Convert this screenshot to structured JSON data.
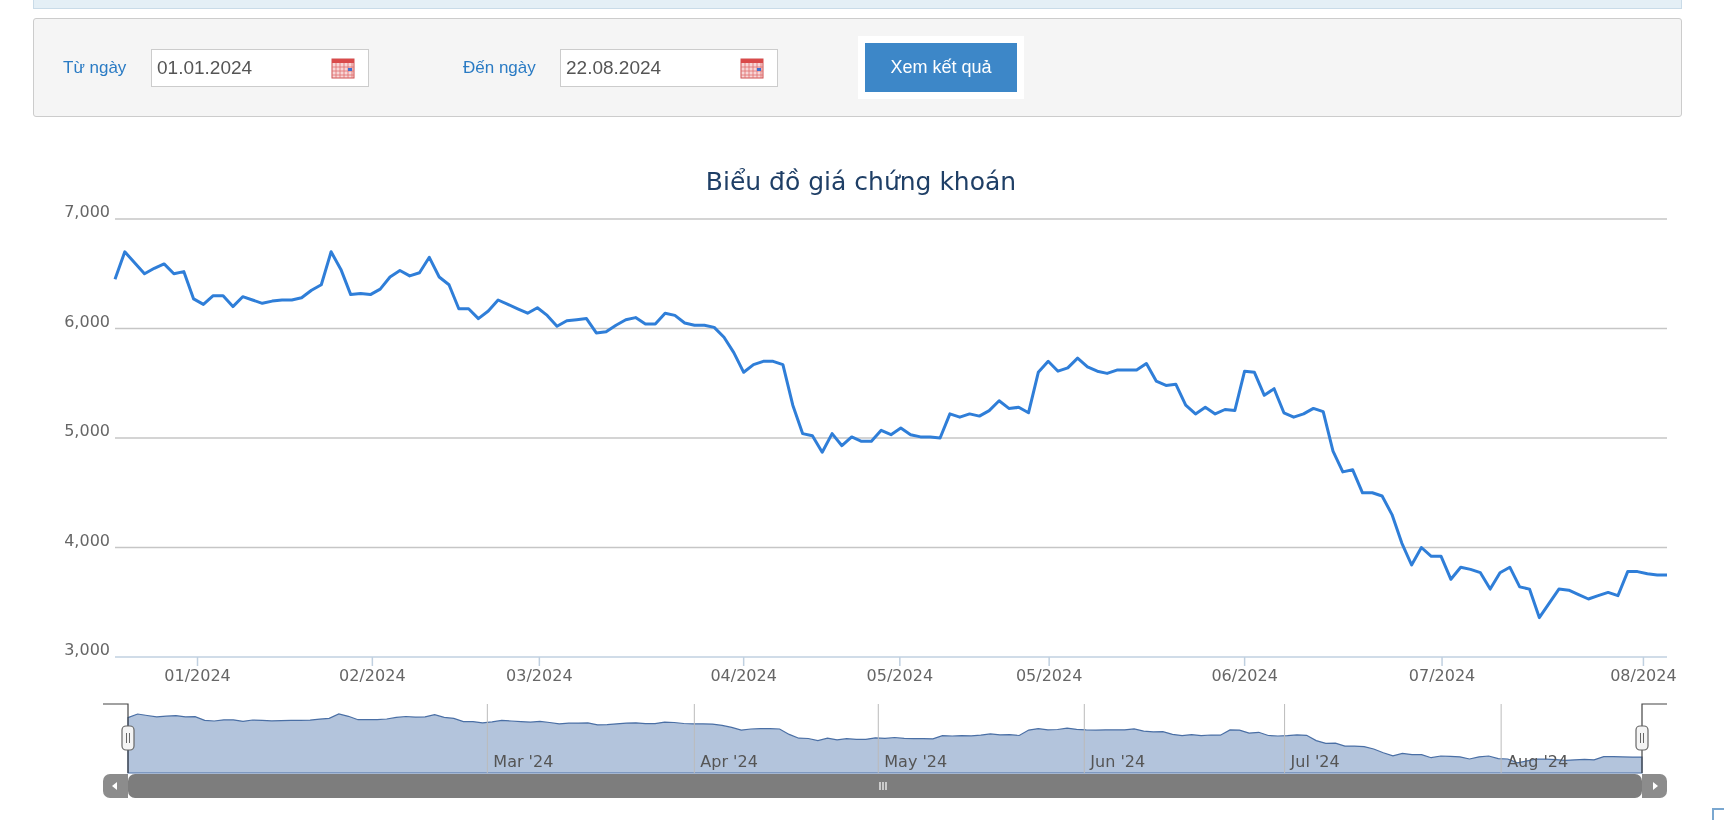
{
  "filter": {
    "from_label": "Từ ngày",
    "from_value": "01.01.2024",
    "to_label": "Đến ngày",
    "to_value": "22.08.2024",
    "submit": "Xem kết quả"
  },
  "chart": {
    "chart_data": {
      "type": "line",
      "title": "Biểu đồ giá chứng khoán",
      "grid": true,
      "ylim": [
        3000,
        7000
      ],
      "yticks": [
        {
          "value": 3000,
          "label": "3,000"
        },
        {
          "value": 4000,
          "label": "4,000"
        },
        {
          "value": 5000,
          "label": "5,000"
        },
        {
          "value": 6000,
          "label": "6,000"
        },
        {
          "value": 7000,
          "label": "7,000"
        }
      ],
      "series": [
        {
          "color": "#2f7ed8",
          "values": [
            6450,
            6700,
            6600,
            6500,
            6550,
            6590,
            6500,
            6520,
            6270,
            6220,
            6300,
            6300,
            6200,
            6290,
            6260,
            6230,
            6250,
            6260,
            6260,
            6280,
            6350,
            6400,
            6700,
            6540,
            6310,
            6320,
            6310,
            6360,
            6470,
            6530,
            6480,
            6510,
            6650,
            6470,
            6400,
            6180,
            6180,
            6090,
            6160,
            6260,
            6220,
            6180,
            6140,
            6190,
            6120,
            6020,
            6070,
            6080,
            6090,
            5960,
            5970,
            6030,
            6080,
            6100,
            6040,
            6040,
            6140,
            6120,
            6050,
            6030,
            6030,
            6010,
            5920,
            5780,
            5600,
            5670,
            5700,
            5700,
            5670,
            5300,
            5040,
            5020,
            4870,
            5040,
            4930,
            5010,
            4970,
            4970,
            5070,
            5030,
            5090,
            5030,
            5010,
            5010,
            5000,
            5220,
            5190,
            5220,
            5200,
            5250,
            5340,
            5270,
            5280,
            5230,
            5600,
            5700,
            5610,
            5640,
            5730,
            5650,
            5610,
            5590,
            5620,
            5620,
            5620,
            5680,
            5520,
            5480,
            5490,
            5300,
            5220,
            5280,
            5220,
            5260,
            5250,
            5610,
            5600,
            5390,
            5450,
            5230,
            5190,
            5220,
            5270,
            5240,
            4880,
            4690,
            4710,
            4500,
            4500,
            4470,
            4300,
            4040,
            3840,
            4000,
            3920,
            3920,
            3710,
            3820,
            3800,
            3770,
            3620,
            3770,
            3820,
            3640,
            3620,
            3360,
            3490,
            3620,
            3610,
            3570,
            3530,
            3560,
            3590,
            3560,
            3780,
            3780,
            3760,
            3750,
            3750
          ]
        }
      ]
    },
    "x_axis_labels": [
      "01/2024",
      "02/2024",
      "03/2024",
      "04/2024",
      "05/2024",
      "05/2024",
      "06/2024",
      "07/2024",
      "08/2024"
    ]
  },
  "navigator": {
    "labels": [
      "Mar '24",
      "Apr '24",
      "May '24",
      "Jun '24",
      "Jul '24",
      "Aug '24"
    ]
  }
}
